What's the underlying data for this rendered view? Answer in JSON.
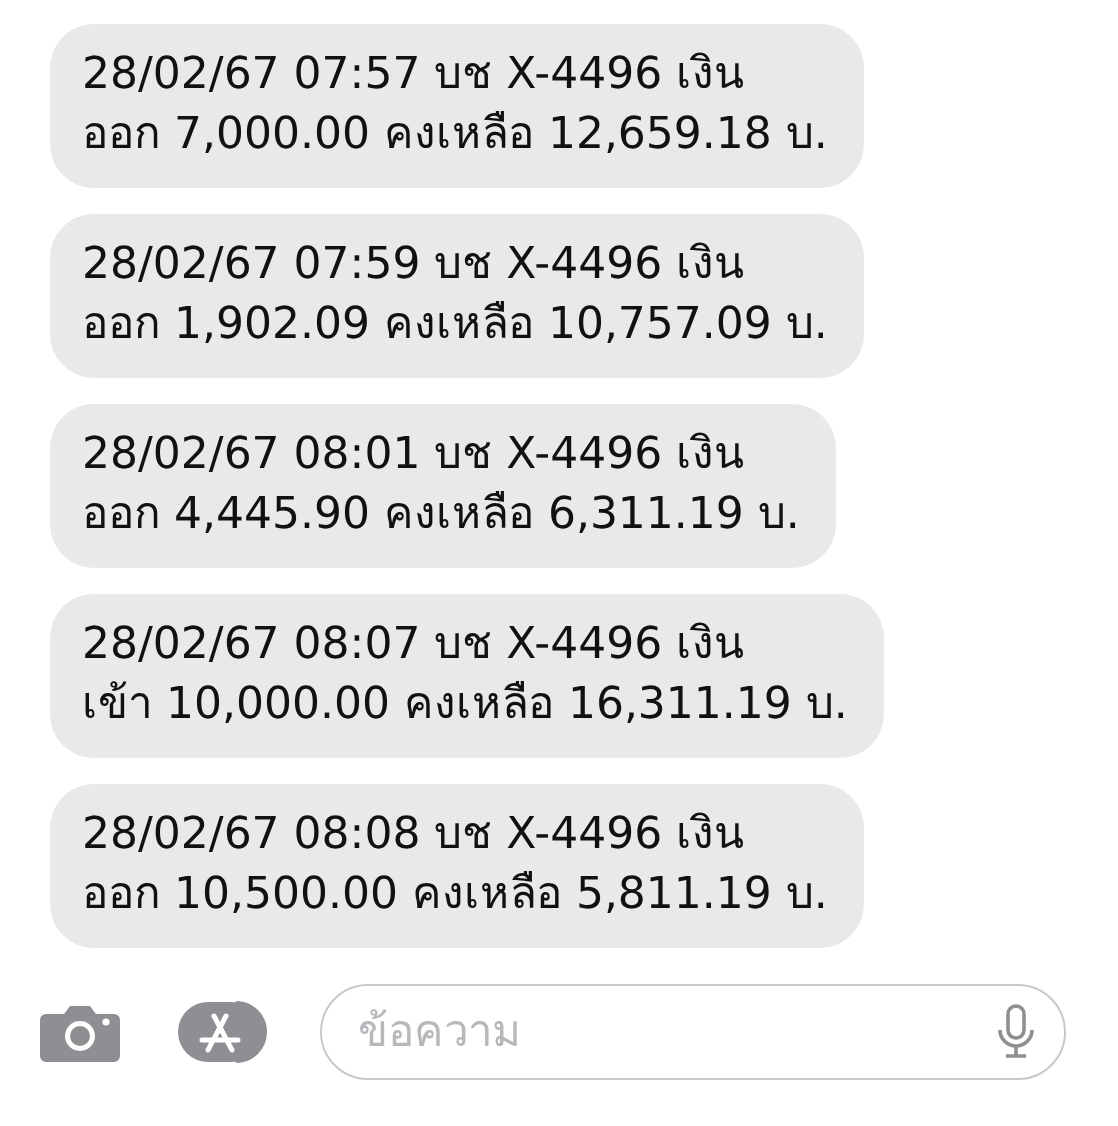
{
  "messages": [
    {
      "lines": [
        "28/02/67 07:57 บช X-4496 เงิน",
        "ออก 7,000.00 คงเหลือ 12,659.18 บ."
      ]
    },
    {
      "lines": [
        "28/02/67 07:59 บช X-4496 เงิน",
        "ออก 1,902.09 คงเหลือ 10,757.09 บ."
      ]
    },
    {
      "lines": [
        "28/02/67 08:01 บช X-4496 เงิน",
        "ออก 4,445.90 คงเหลือ 6,311.19 บ."
      ]
    },
    {
      "lines": [
        "28/02/67 08:07 บช X-4496 เงิน",
        "เข้า 10,000.00 คงเหลือ 16,311.19 บ."
      ]
    },
    {
      "lines": [
        "28/02/67 08:08 บช X-4496 เงิน",
        "ออก 10,500.00 คงเหลือ 5,811.19 บ."
      ]
    }
  ],
  "composer": {
    "placeholder": "ข้อความ"
  }
}
